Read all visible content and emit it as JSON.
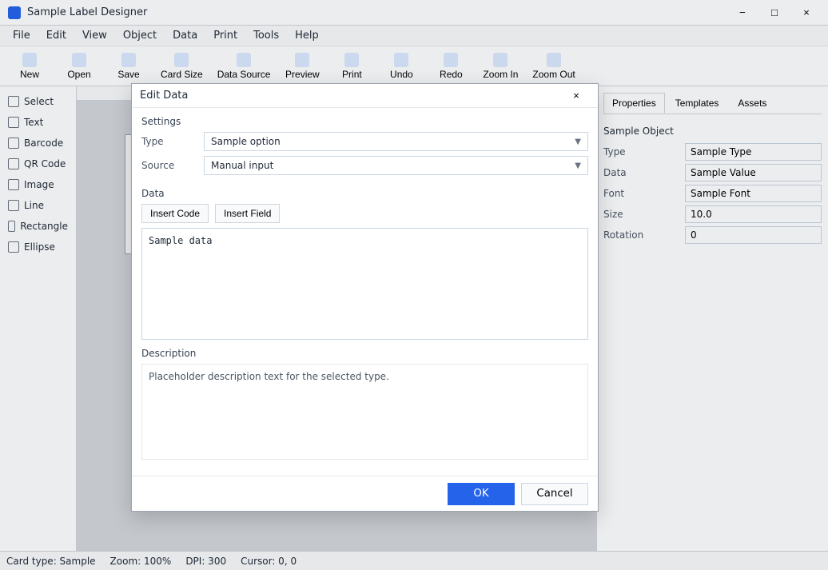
{
  "app": {
    "title": "Sample Label Designer",
    "accent_color": "#2563eb",
    "icon_name": "app-logo-icon"
  },
  "menu": {
    "items": [
      {
        "label": "File"
      },
      {
        "label": "Edit"
      },
      {
        "label": "View"
      },
      {
        "label": "Object"
      },
      {
        "label": "Data"
      },
      {
        "label": "Print"
      },
      {
        "label": "Tools"
      },
      {
        "label": "Help"
      }
    ]
  },
  "toolbar": {
    "buttons": [
      {
        "label": "New",
        "icon": "new-file-icon"
      },
      {
        "label": "Open",
        "icon": "folder-open-icon"
      },
      {
        "label": "Save",
        "icon": "save-icon"
      },
      {
        "label": "Card Size",
        "icon": "page-size-icon"
      },
      {
        "label": "Data Source",
        "icon": "database-icon"
      },
      {
        "label": "Preview",
        "icon": "preview-icon"
      },
      {
        "label": "Print",
        "icon": "printer-icon"
      },
      {
        "label": "Undo",
        "icon": "undo-icon"
      },
      {
        "label": "Redo",
        "icon": "redo-icon"
      },
      {
        "label": "Zoom In",
        "icon": "zoom-in-icon"
      },
      {
        "label": "Zoom Out",
        "icon": "zoom-out-icon"
      }
    ]
  },
  "palette": {
    "items": [
      {
        "label": "Select",
        "icon": "pointer-icon"
      },
      {
        "label": "Text",
        "icon": "text-icon"
      },
      {
        "label": "Barcode",
        "icon": "barcode-icon"
      },
      {
        "label": "QR Code",
        "icon": "qr-code-icon"
      },
      {
        "label": "Image",
        "icon": "image-icon"
      },
      {
        "label": "Line",
        "icon": "line-icon"
      },
      {
        "label": "Rectangle",
        "icon": "rectangle-icon"
      },
      {
        "label": "Ellipse",
        "icon": "ellipse-icon"
      }
    ]
  },
  "properties": {
    "tabs": [
      {
        "label": "Properties"
      },
      {
        "label": "Templates"
      },
      {
        "label": "Assets"
      }
    ],
    "object_name": "Sample Object",
    "rows": [
      {
        "label": "Type",
        "value": "Sample Type"
      },
      {
        "label": "Data",
        "value": "Sample Value"
      },
      {
        "label": "Font",
        "value": "Sample Font"
      },
      {
        "label": "Size",
        "value": "10.0"
      },
      {
        "label": "Rotation",
        "value": "0"
      }
    ]
  },
  "status": {
    "items": [
      {
        "text": "Card type: Sample"
      },
      {
        "text": "Zoom: 100%"
      },
      {
        "text": "DPI: 300"
      },
      {
        "text": "Cursor: 0, 0"
      }
    ]
  },
  "dialog": {
    "title": "Edit Data",
    "settings_group": "Settings",
    "type_label": "Type",
    "type_value": "Sample option",
    "source_label": "Source",
    "source_value": "Manual input",
    "editor_group": "Data",
    "editor_buttons": [
      {
        "label": "Insert Code"
      },
      {
        "label": "Insert Field"
      }
    ],
    "editor_value": "Sample data",
    "notes_group": "Description",
    "notes_text": "Placeholder description text for the selected type.",
    "ok_label": "OK",
    "cancel_label": "Cancel"
  }
}
